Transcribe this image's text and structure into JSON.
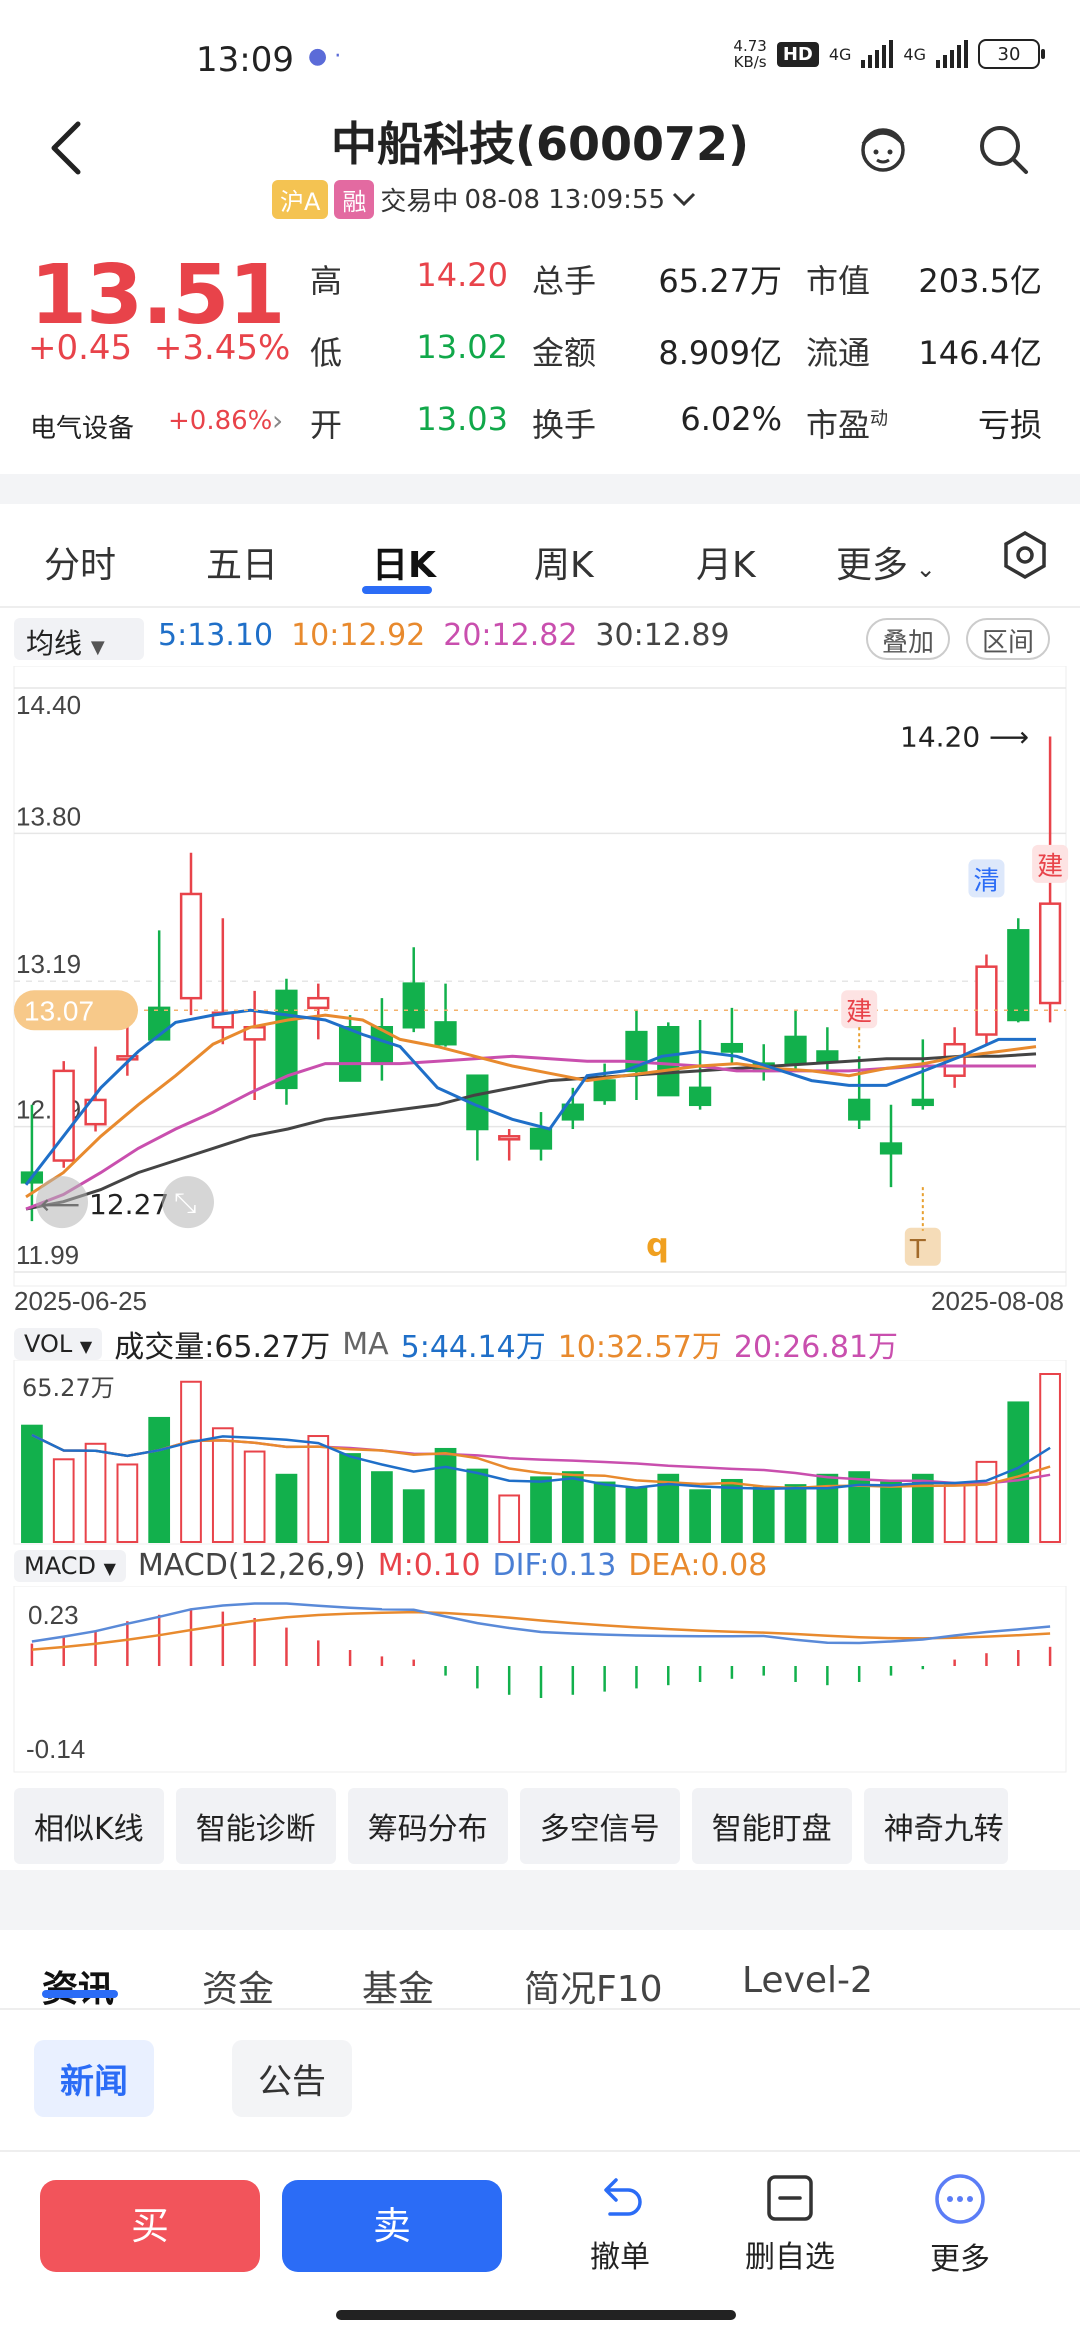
{
  "status": {
    "time": "13:09",
    "net_speed_top": "4.73",
    "net_speed_bottom": "KB/s",
    "hd": "HD",
    "net1": "4G",
    "net2": "4G",
    "battery": "30"
  },
  "header": {
    "title": "中船科技(600072)",
    "badge_market": "沪A",
    "badge_margin": "融",
    "trade_status": "交易中",
    "timestamp": "08-08 13:09:55"
  },
  "quote": {
    "price": "13.51",
    "change": "+0.45",
    "change_pct": "+3.45%",
    "sector": "电气设备",
    "sector_chg": "+0.86%",
    "rows": [
      [
        {
          "label": "高",
          "value": "14.20",
          "color": "red"
        },
        {
          "label": "总手",
          "value": "65.27万"
        },
        {
          "label": "市值",
          "value": "203.5亿"
        }
      ],
      [
        {
          "label": "低",
          "value": "13.02",
          "color": "green"
        },
        {
          "label": "金额",
          "value": "8.909亿"
        },
        {
          "label": "流通",
          "value": "146.4亿"
        }
      ],
      [
        {
          "label": "开",
          "value": "13.03",
          "color": "green"
        },
        {
          "label": "换手",
          "value": "6.02%"
        },
        {
          "label": "市盈动",
          "value": "亏损"
        }
      ]
    ]
  },
  "tabs": [
    "分时",
    "五日",
    "日K",
    "周K",
    "月K",
    "更多"
  ],
  "active_tab": "日K",
  "ma": {
    "select": "均线",
    "ma5": "5:13.10",
    "ma10": "10:12.92",
    "ma20": "20:12.82",
    "ma30": "30:12.89",
    "btn_overlay": "叠加",
    "btn_range": "区间"
  },
  "chart_data": {
    "type": "candlestick",
    "y_axis_labels": [
      "14.40",
      "13.80",
      "13.19",
      "12.59",
      "11.99"
    ],
    "ylim": [
      11.99,
      14.4
    ],
    "x_start_label": "2025-06-25",
    "x_end_label": "2025-08-08",
    "current_price_tag": "13.07",
    "high_annotation": "14.20",
    "low_annotation": "12.27",
    "marker_q": "q",
    "signal_labels": {
      "build": "建",
      "clear": "清",
      "t": "T"
    },
    "candles": [
      [
        12.4,
        12.68,
        12.2,
        12.36
      ],
      [
        12.45,
        12.86,
        12.42,
        12.82
      ],
      [
        12.6,
        12.92,
        12.57,
        12.7
      ],
      [
        12.88,
        13.1,
        12.8,
        12.88
      ],
      [
        13.08,
        13.4,
        12.95,
        12.95
      ],
      [
        13.12,
        13.72,
        13.05,
        13.55
      ],
      [
        13.0,
        13.45,
        12.93,
        13.06
      ],
      [
        12.95,
        13.15,
        12.7,
        13.0
      ],
      [
        13.15,
        13.2,
        12.68,
        12.75
      ],
      [
        13.08,
        13.18,
        12.95,
        13.12
      ],
      [
        13.0,
        13.05,
        12.78,
        12.78
      ],
      [
        13.0,
        13.12,
        12.78,
        12.85
      ],
      [
        13.18,
        13.33,
        12.98,
        13.0
      ],
      [
        13.02,
        13.18,
        12.92,
        12.93
      ],
      [
        12.8,
        12.8,
        12.45,
        12.58
      ],
      [
        12.55,
        12.58,
        12.45,
        12.55
      ],
      [
        12.58,
        12.65,
        12.45,
        12.5
      ],
      [
        12.68,
        12.75,
        12.58,
        12.62
      ],
      [
        12.78,
        12.85,
        12.68,
        12.7
      ],
      [
        12.98,
        13.07,
        12.7,
        12.82
      ],
      [
        13.0,
        13.02,
        12.72,
        12.72
      ],
      [
        12.75,
        13.03,
        12.66,
        12.68
      ],
      [
        12.93,
        13.08,
        12.85,
        12.9
      ],
      [
        12.85,
        12.93,
        12.78,
        12.82
      ],
      [
        12.96,
        13.07,
        12.82,
        12.85
      ],
      [
        12.9,
        13.0,
        12.82,
        12.86
      ],
      [
        12.7,
        12.88,
        12.58,
        12.62
      ],
      [
        12.52,
        12.68,
        12.34,
        12.48
      ],
      [
        12.7,
        12.95,
        12.66,
        12.68
      ],
      [
        12.8,
        13.0,
        12.75,
        12.93
      ],
      [
        12.97,
        13.3,
        12.93,
        13.25
      ],
      [
        13.4,
        13.45,
        13.02,
        13.03
      ],
      [
        13.1,
        14.2,
        13.02,
        13.51
      ]
    ],
    "ma5": [
      12.35,
      12.55,
      12.75,
      12.9,
      13.02,
      13.05,
      13.07,
      13.05,
      13.03,
      12.97,
      12.92,
      12.75,
      12.68,
      12.62,
      12.58,
      12.8,
      12.82,
      12.88,
      12.9,
      12.88,
      12.83,
      12.78,
      12.76,
      12.76,
      12.82,
      12.88,
      12.95,
      12.95
    ],
    "ma10": [
      12.3,
      12.4,
      12.55,
      12.68,
      12.8,
      12.93,
      13.0,
      13.03,
      13.05,
      13.03,
      12.95,
      12.92,
      12.88,
      12.84,
      12.81,
      12.78,
      12.8,
      12.82,
      12.84,
      12.85,
      12.83,
      12.82,
      12.8,
      12.83,
      12.85,
      12.88,
      12.9,
      12.92
    ],
    "ma20": [
      12.25,
      12.31,
      12.4,
      12.5,
      12.58,
      12.65,
      12.73,
      12.8,
      12.85,
      12.85,
      12.85,
      12.86,
      12.87,
      12.88,
      12.87,
      12.86,
      12.86,
      12.85,
      12.84,
      12.82,
      12.82,
      12.82,
      12.82,
      12.83,
      12.84,
      12.84,
      12.84,
      12.84
    ],
    "ma30": [
      12.25,
      12.28,
      12.33,
      12.4,
      12.45,
      12.5,
      12.55,
      12.58,
      12.62,
      12.64,
      12.66,
      12.68,
      12.72,
      12.75,
      12.78,
      12.79,
      12.8,
      12.81,
      12.82,
      12.83,
      12.84,
      12.85,
      12.86,
      12.87,
      12.87,
      12.88,
      12.88,
      12.89
    ],
    "volume": {
      "label": "VOL",
      "total": "成交量:65.27万",
      "ma_label": "MA",
      "ma5": "5:44.14万",
      "ma10": "10:32.57万",
      "ma20": "20:26.81万",
      "y_top_label": "65.27万",
      "bars": [
        45,
        32,
        38,
        30,
        48,
        62,
        44,
        35,
        26,
        41,
        34,
        27,
        20,
        36,
        28,
        18,
        25,
        27,
        23,
        21,
        26,
        20,
        24,
        21,
        22,
        26,
        27,
        23,
        26,
        22,
        31,
        54,
        65
      ]
    },
    "macd": {
      "label": "MACD",
      "params": "MACD(12,26,9)",
      "m": "M:0.10",
      "dif": "DIF:0.13",
      "dea": "DEA:0.08",
      "y_top_label": "0.23",
      "y_bottom_label": "-0.14",
      "hist": [
        0.07,
        0.09,
        0.11,
        0.14,
        0.16,
        0.18,
        0.17,
        0.15,
        0.12,
        0.08,
        0.05,
        0.03,
        0.02,
        -0.03,
        -0.07,
        -0.09,
        -0.1,
        -0.09,
        -0.08,
        -0.07,
        -0.06,
        -0.05,
        -0.04,
        -0.03,
        -0.05,
        -0.06,
        -0.05,
        -0.03,
        -0.01,
        0.02,
        0.04,
        0.05,
        0.06
      ]
    }
  },
  "tools": [
    "相似K线",
    "智能诊断",
    "筹码分布",
    "多空信号",
    "智能盯盘",
    "神奇九转"
  ],
  "info_tabs": [
    "资讯",
    "资金",
    "基金",
    "简况F10",
    "Level-2"
  ],
  "chips": [
    "新闻",
    "公告"
  ],
  "bottom": {
    "buy": "买",
    "sell": "卖",
    "cancel": "撤单",
    "delete_fav": "删自选",
    "more": "更多"
  }
}
